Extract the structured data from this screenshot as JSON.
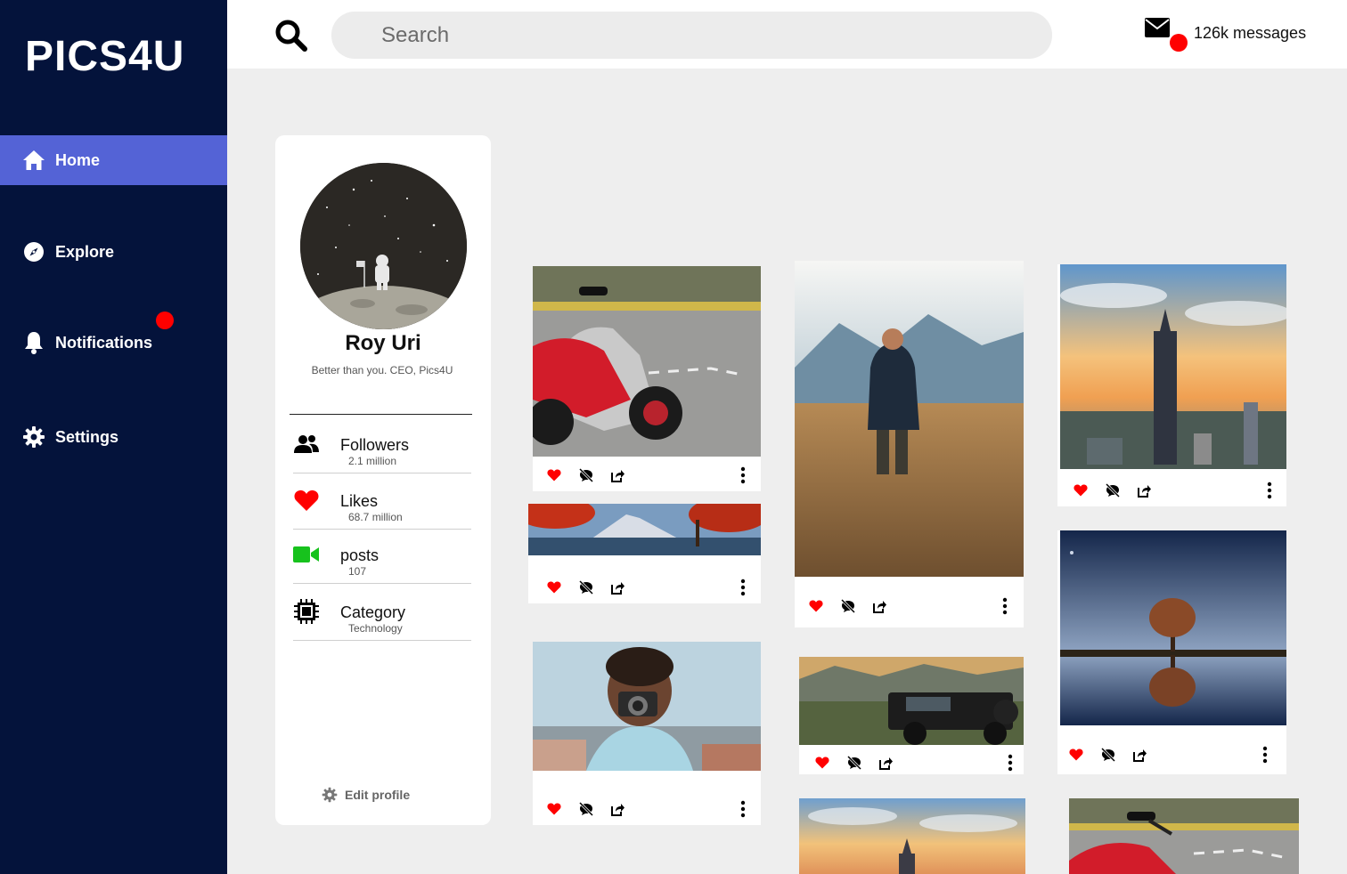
{
  "app": {
    "logo": "PICS4U"
  },
  "sidebar": {
    "items": [
      {
        "label": "Home",
        "icon": "home-icon",
        "active": true
      },
      {
        "label": "Explore",
        "icon": "compass-icon",
        "active": false
      },
      {
        "label": "Notifications",
        "icon": "bell-icon",
        "active": false,
        "has_badge": true
      },
      {
        "label": "Settings",
        "icon": "gear-icon",
        "active": false
      }
    ]
  },
  "topbar": {
    "search_placeholder": "Search",
    "messages_label": "126k messages"
  },
  "profile": {
    "name": "Roy Uri",
    "bio": "Better than you. CEO, Pics4U",
    "stats": [
      {
        "label": "Followers",
        "value": "2.1 million",
        "icon": "people-icon"
      },
      {
        "label": "Likes",
        "value": "68.7 million",
        "icon": "heart-icon"
      },
      {
        "label": "posts",
        "value": "107",
        "icon": "video-camera-icon"
      },
      {
        "label": "Category",
        "value": "Technology",
        "icon": "chip-icon"
      }
    ],
    "edit_label": "Edit profile"
  },
  "feed": {
    "posts": [
      {
        "subject": "red scooter on road"
      },
      {
        "subject": "mountain with red autumn trees"
      },
      {
        "subject": "woman holding camera"
      },
      {
        "subject": "man standing in golden field"
      },
      {
        "subject": "black jeep on misty hill"
      },
      {
        "subject": "city tower at sunset"
      },
      {
        "subject": "tree reflection at night"
      },
      {
        "subject": "city tower at sunset"
      },
      {
        "subject": "red scooter on road"
      }
    ]
  },
  "colors": {
    "sidebar_bg": "#04133b",
    "active_nav": "#5463d6",
    "badge": "#ff0000",
    "like": "#ff0000",
    "video_icon": "#17c21d",
    "page_bg": "#eeeeee"
  }
}
